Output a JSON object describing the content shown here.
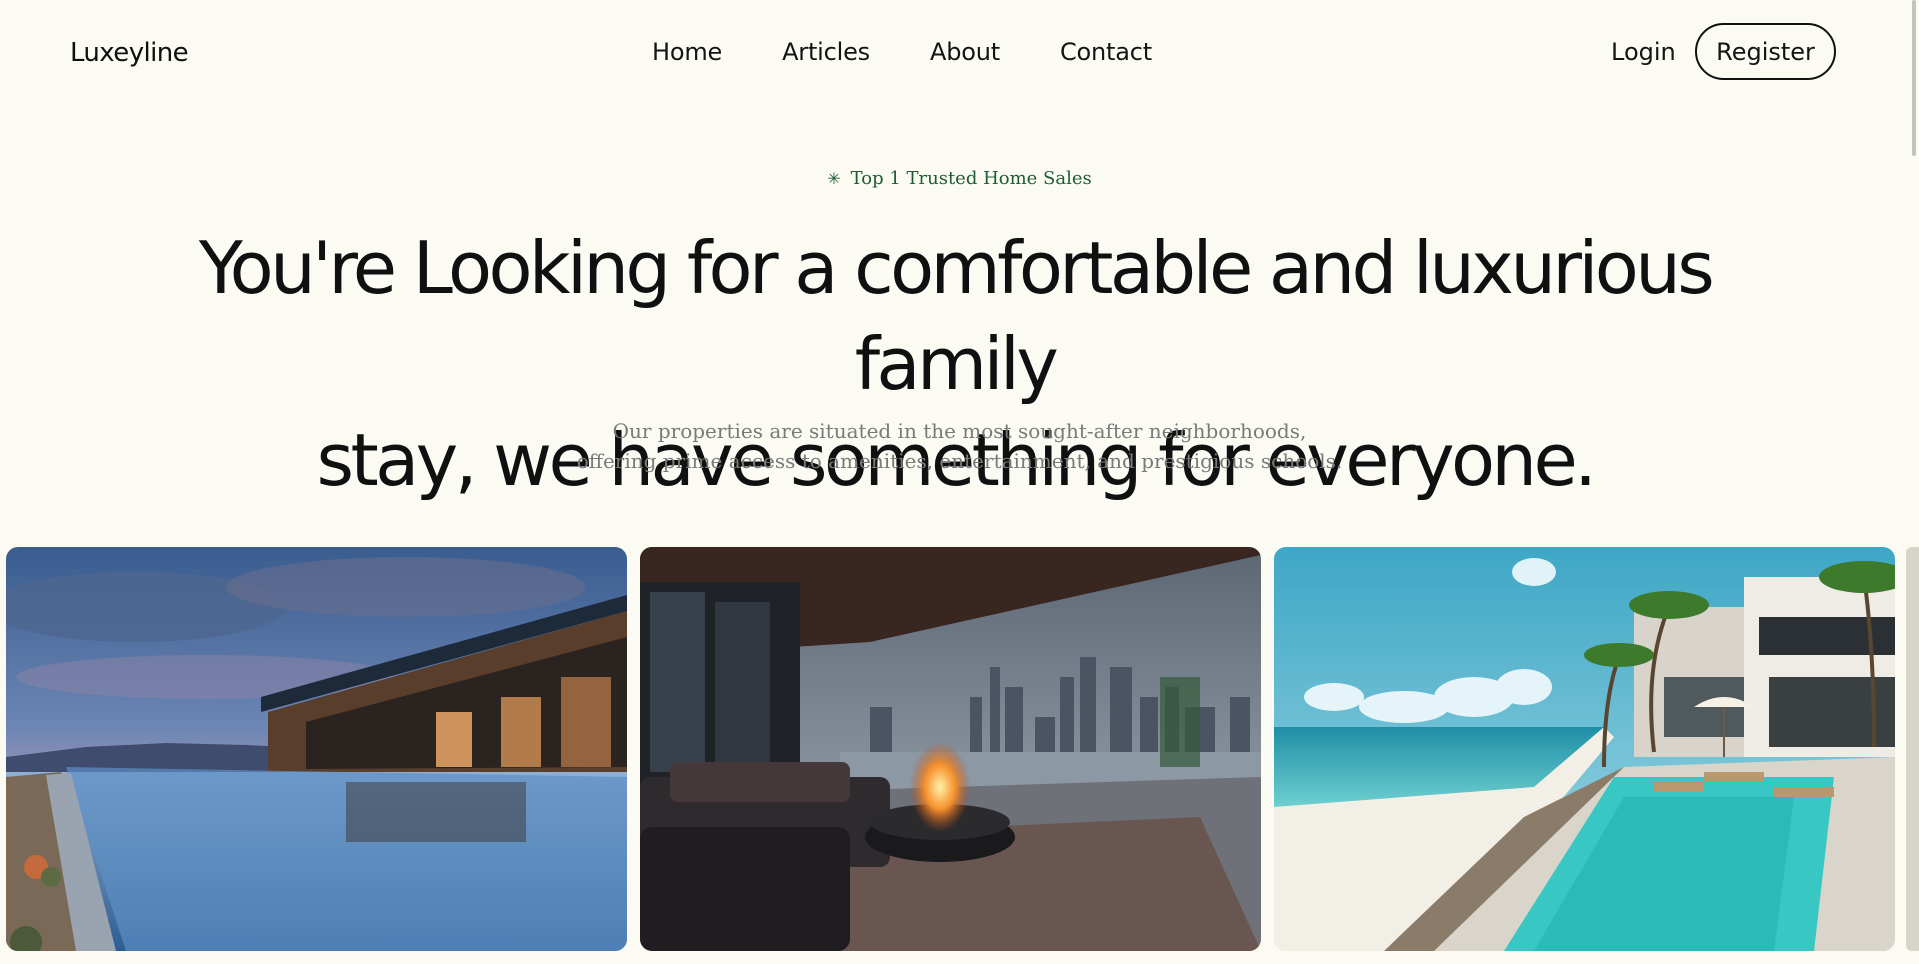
{
  "nav": {
    "logo": "Luxeyline",
    "links": [
      {
        "label": "Home"
      },
      {
        "label": "Articles"
      },
      {
        "label": "About"
      },
      {
        "label": "Contact"
      }
    ],
    "login_label": "Login",
    "register_label": "Register"
  },
  "hero": {
    "badge_icon": "sparkle-icon",
    "badge_text": "Top 1 Trusted Home Sales",
    "headline_line1": "You're Looking for a comfortable and luxurious family",
    "headline_line2": "stay, we have something for everyone.",
    "subtitle_line1": "Our properties are situated in the most sought-after neighborhoods,",
    "subtitle_line2": "offering prime access to amenities, entertainment, and prestigious schools."
  },
  "gallery": {
    "images": [
      {
        "name": "desert-villa-infinity-pool-photo"
      },
      {
        "name": "rooftop-lounge-fire-pit-city-view-photo"
      },
      {
        "name": "beachfront-villa-pool-photo"
      }
    ]
  },
  "colors": {
    "background": "#fcfbf3",
    "text": "#0f0f0f",
    "badge": "#1e5b36",
    "subtitle": "#7a7a7a"
  }
}
